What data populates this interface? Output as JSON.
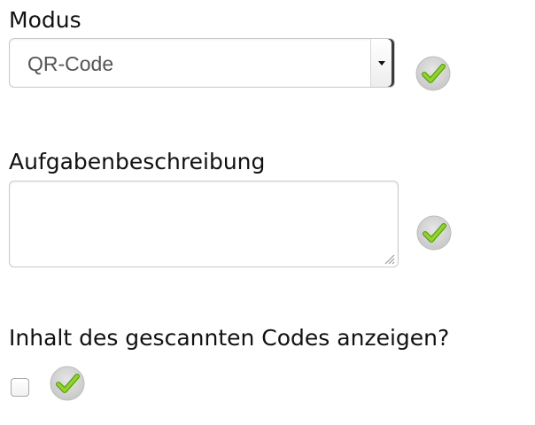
{
  "form": {
    "mode": {
      "label": "Modus",
      "selected_value": "QR-Code",
      "options": [
        "QR-Code"
      ],
      "status_icon": "check-icon"
    },
    "description": {
      "label": "Aufgabenbeschreibung",
      "value": "",
      "placeholder": "",
      "status_icon": "check-icon"
    },
    "show_content": {
      "label": "Inhalt des gescannten Codes anzeigen?",
      "checked": false,
      "status_icon": "check-icon"
    }
  },
  "colors": {
    "check_green": "#7cc61c",
    "check_badge": "#d6d6d6",
    "border": "#c9c9c9",
    "text": "#111111"
  }
}
